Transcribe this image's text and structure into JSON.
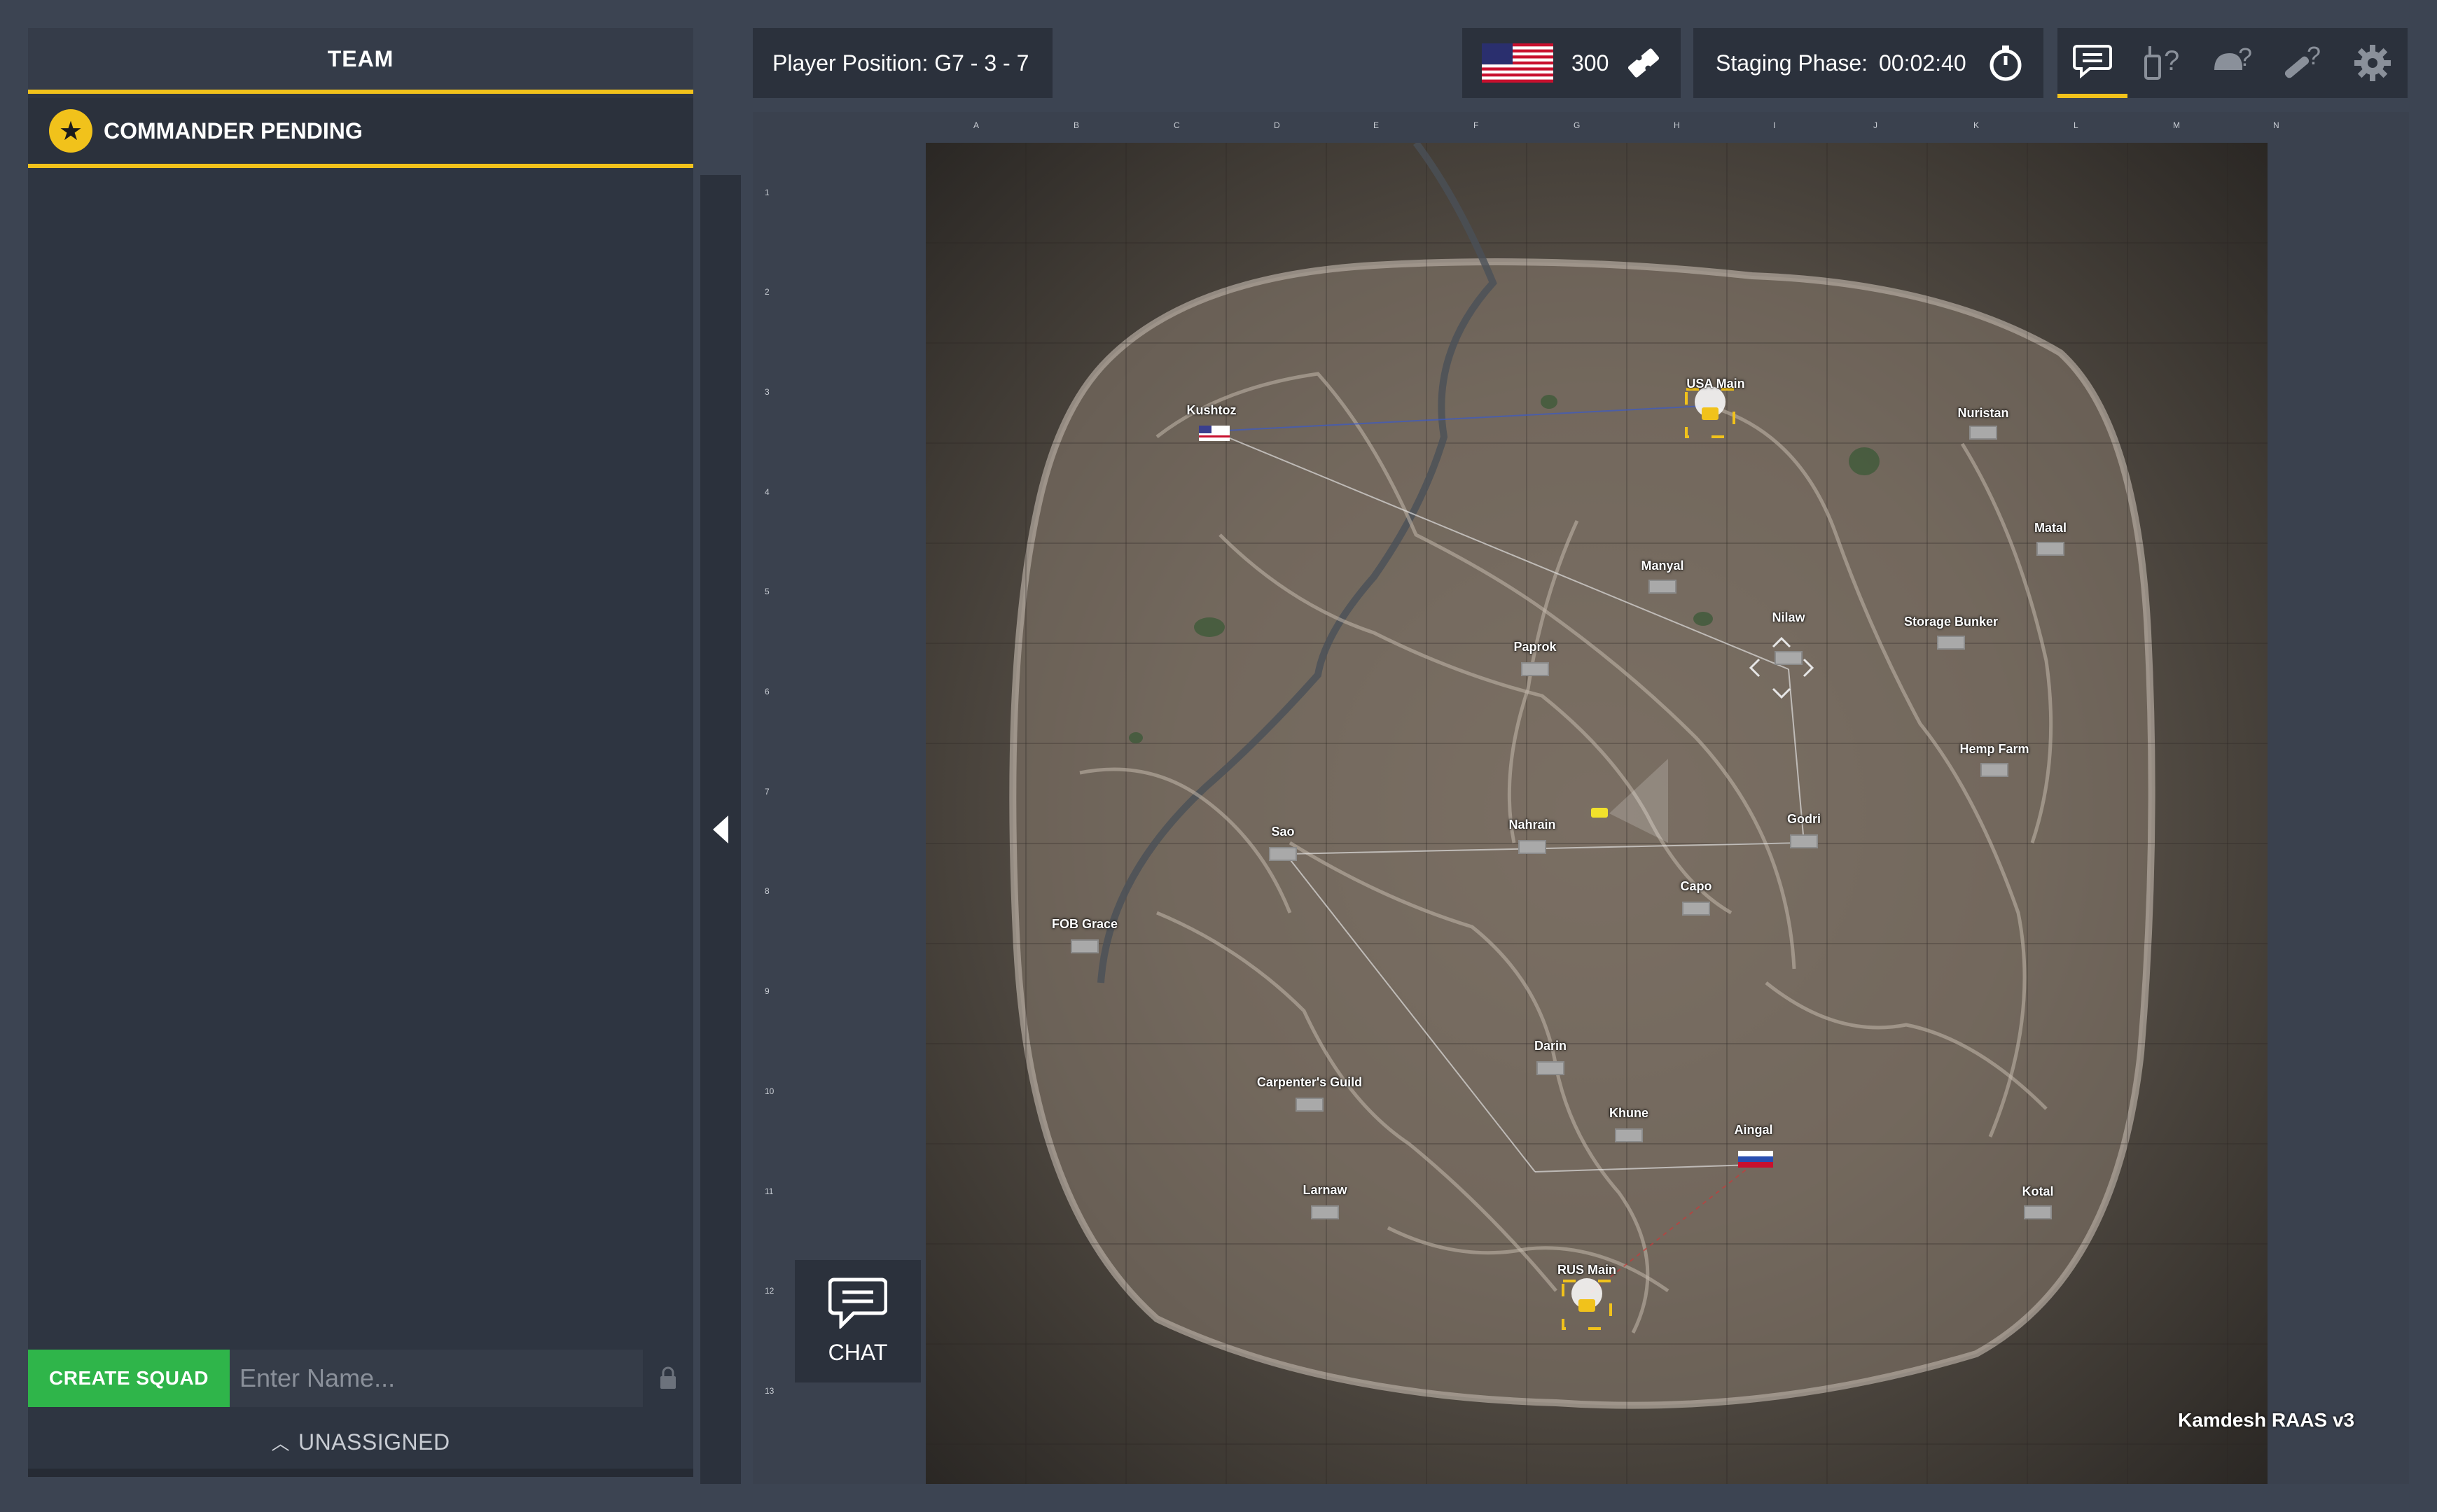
{
  "team_panel": {
    "title": "TEAM",
    "commander_status": "COMMANDER PENDING",
    "create_squad_label": "CREATE SQUAD",
    "squad_name_placeholder": "Enter Name...",
    "unassigned_label": "UNASSIGNED"
  },
  "top_bar": {
    "player_position": "Player Position: G7 - 3 - 7",
    "tickets": "300",
    "staging_label": "Staging Phase:",
    "staging_time": "00:02:40",
    "icons": [
      "chat-icon",
      "radio-help-icon",
      "helmet-help-icon",
      "rocket-help-icon",
      "gear-icon"
    ]
  },
  "map": {
    "name": "Kamdesh RAAS v3",
    "grid_columns": [
      "A",
      "B",
      "C",
      "D",
      "E",
      "F",
      "G",
      "H",
      "I",
      "J",
      "K",
      "L",
      "M",
      "N"
    ],
    "grid_rows": [
      "1",
      "2",
      "3",
      "4",
      "5",
      "6",
      "7",
      "8",
      "9",
      "10",
      "11",
      "12",
      "13"
    ],
    "points_of_interest": {
      "usa_main": "USA Main",
      "kushtoz": "Kushtoz",
      "nuristan": "Nuristan",
      "matal": "Matal",
      "manyal": "Manyal",
      "nilaw": "Nilaw",
      "storage_bunker": "Storage Bunker",
      "paprok": "Paprok",
      "hemp_farm": "Hemp Farm",
      "godri": "Godri",
      "nahrain": "Nahrain",
      "sao": "Sao",
      "capo": "Capo",
      "fob_grace": "FOB Grace",
      "darin": "Darin",
      "carpenters_guild": "Carpenter's Guild",
      "khune": "Khune",
      "aingal": "Aingal",
      "larnaw": "Larnaw",
      "kotal": "Kotal",
      "rus_main": "RUS Main"
    }
  },
  "chat_button_label": "CHAT",
  "colors": {
    "accent": "#f1c21b",
    "create_squad": "#2fb54a",
    "panel": "#2e3541",
    "background": "#3c4452"
  }
}
